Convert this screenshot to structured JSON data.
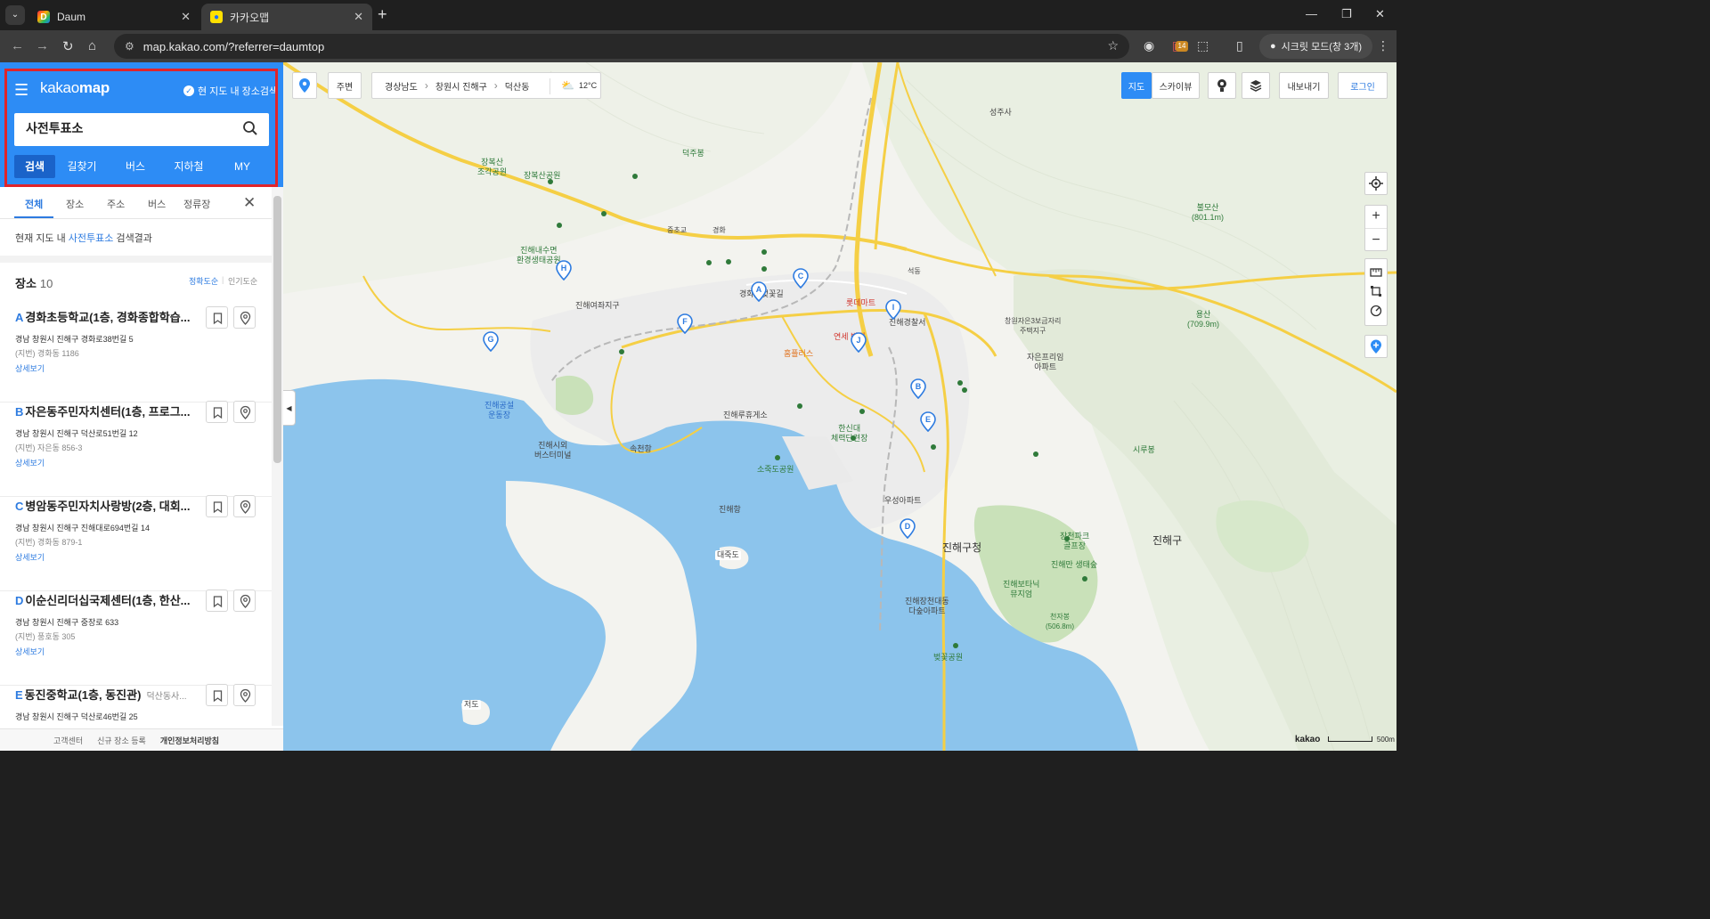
{
  "browser": {
    "tab_list": "⌄",
    "tabs": [
      {
        "title": "Daum",
        "favicon": "D",
        "close": "✕"
      },
      {
        "title": "카카오맵",
        "favicon": "●",
        "close": "✕"
      }
    ],
    "new_tab": "+",
    "controls": {
      "minimize": "—",
      "restore": "❐",
      "close": "✕"
    },
    "url": "map.kakao.com/?referrer=daumtop",
    "extension_badge": "14",
    "incognito_label": "시크릿 모드(창 3개)"
  },
  "header": {
    "menu": "☰",
    "logo_pre": "kakao",
    "logo_bold": "map",
    "scope_check": "✓",
    "scope_label": "현 지도 내 장소검색",
    "search_value": "사전투표소"
  },
  "main_tabs": [
    "검색",
    "길찾기",
    "버스",
    "지하철",
    "MY"
  ],
  "sub_tabs": [
    "전체",
    "장소",
    "주소",
    "버스",
    "정류장"
  ],
  "sub_close": "✕",
  "result_note": {
    "pre": "현재 지도 내 ",
    "keyword": "사전투표소",
    "post": " 검색결과"
  },
  "list": {
    "title": "장소",
    "count": "10",
    "sort_accuracy": "정확도순",
    "sort_sep": "|",
    "sort_popular": "인기도순",
    "more_label": "상세보기",
    "places": [
      {
        "marker": "A",
        "name": "경화초등학교(1층, 경화종합학습...",
        "sub": "",
        "addr": "경남 창원시 진해구 경화로38번길 5",
        "jibun": "(지번) 경화동 1186"
      },
      {
        "marker": "B",
        "name": "자은동주민자치센터(1층, 프로그...",
        "sub": "",
        "addr": "경남 창원시 진해구 덕산로51번길 12",
        "jibun": "(지번) 자은동 856-3"
      },
      {
        "marker": "C",
        "name": "병암동주민자치사랑방(2층, 대회...",
        "sub": "",
        "addr": "경남 창원시 진해구 진해대로694번길 14",
        "jibun": "(지번) 경화동 879-1"
      },
      {
        "marker": "D",
        "name": "이순신리더십국제센터(1층, 한산...",
        "sub": "",
        "addr": "경남 창원시 진해구 중장로 633",
        "jibun": "(지번) 풍호동 305"
      },
      {
        "marker": "E",
        "name": "동진중학교(1층, 동진관)",
        "sub": "덕산동사...",
        "addr": "경남 창원시 진해구 덕산로46번길 25",
        "jibun": ""
      }
    ]
  },
  "footer": [
    "고객센터",
    "신규 장소 등록",
    "개인정보처리방침"
  ],
  "map": {
    "collapse_arrow": "◀",
    "top_bar": {
      "nearby": "주변",
      "region": [
        "경상남도",
        "창원시 진해구",
        "덕산동"
      ],
      "weather_icon": "⛅",
      "temperature": "12°C"
    },
    "controls": {
      "map": "지도",
      "skyview": "스카이뷰",
      "export": "내보내기",
      "login": "로그인",
      "zoom_in": "+",
      "zoom_out": "−"
    },
    "scale": {
      "brand": "kakao",
      "distance": "500m"
    },
    "labels": {
      "seongjusa": "성주사",
      "deokjubong": "덕주봉",
      "bulmosan": "불모산\n(801.1m)",
      "jangboksan_park": "장복산\n조각공원",
      "jangboksan": "장복산공원",
      "ecopark": "진해내수면\n환경생태공원",
      "yeojwa": "진해여좌지구",
      "beotkkot": "경화역벚꽃길",
      "lotte": "롯데마트",
      "police": "진해경찰서",
      "hospital": "연세 병원",
      "homeplus": "홈플러스",
      "jaeun_apt": "창원자은3보금자리\n주택지구",
      "jaeun_prugio": "자은프리임\n아파트",
      "yongsan": "용산\n(709.9m)",
      "gongseol": "진해공설\n운동장",
      "terminal": "진해시외\n버스터미널",
      "sokcheon": "속천항",
      "cruise": "진해루휴게소",
      "hansan": "한신대\n체력단련장",
      "sojuk": "소죽도공원",
      "uosung": "우성아파트",
      "jinhae_port": "진해항",
      "daejukdo": "대죽도",
      "jinhae_gu_office": "진해구청",
      "jangcheon_park": "장천파크\n골프장",
      "jinhae_bay": "진해만 생태숲",
      "botanic": "진해보타닉\n뮤지엄",
      "cheonjabong": "천자봉\n(506.8m)",
      "jinhae_gu": "진해구",
      "jangcheon_apt": "진해장천대동\n다숲아파트",
      "beotkkot_park": "벚꽃공원",
      "jeodo": "저도",
      "sirubong": "시루봉",
      "gyeonghwa": "경화",
      "jungchogyo": "중초교",
      "seokdong": "석동"
    },
    "pins": [
      "A",
      "B",
      "C",
      "D",
      "E",
      "F",
      "G",
      "H",
      "I",
      "J"
    ]
  },
  "colors": {
    "brand": "#2d8cf5",
    "highlight": "#e0242a",
    "sea": "#8cc4ec",
    "road": "#f5cf45",
    "park": "#cfe5c0"
  }
}
